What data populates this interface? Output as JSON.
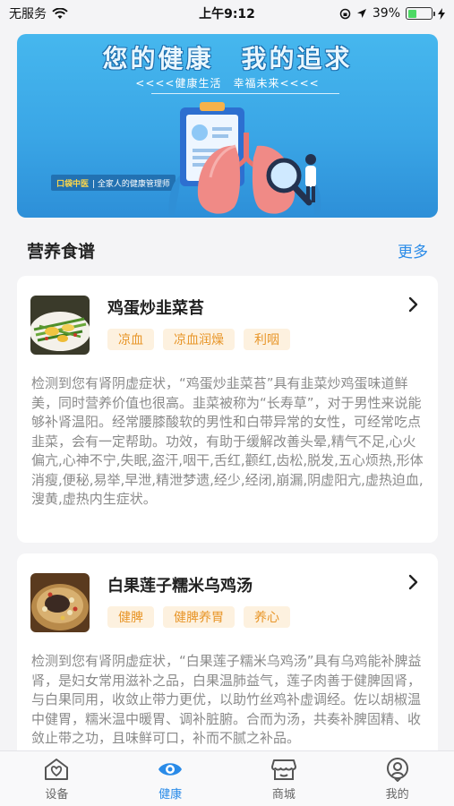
{
  "status_bar": {
    "carrier": "无服务",
    "time": "上午9:12",
    "battery_percent": "39%",
    "battery_level": 0.39
  },
  "banner": {
    "title": "您的健康　我的追求",
    "subtitle": "<<<<健康生活　幸福未来<<<<",
    "brand": "口袋中医",
    "brand_tagline": "| 全家人的健康管理师"
  },
  "section": {
    "title": "营养食谱",
    "more_label": "更多"
  },
  "recipes": [
    {
      "name": "鸡蛋炒韭菜苔",
      "tags": [
        "凉血",
        "凉血润燥",
        "利咽"
      ],
      "description": "检测到您有肾阴虚症状，“鸡蛋炒韭菜苔”具有韭菜炒鸡蛋味道鲜美，同时营养价值也很高。韭菜被称为“长寿草”，对于男性来说能够补肾温阳。经常腰膝酸软的男性和白带异常的女性，可经常吃点韭菜，会有一定帮助。功效，有助于缓解改善头晕,精气不足,心火偏亢,心神不宁,失眠,盗汗,咽干,舌红,颧红,齿松,脱发,五心烦热,形体消瘦,便秘,易举,早泄,精泄梦遗,经少,经闭,崩漏,阴虚阳亢,虚热迫血,溲黄,虚热内生症状。"
    },
    {
      "name": "白果莲子糯米乌鸡汤",
      "tags": [
        "健脾",
        "健脾养胃",
        "养心"
      ],
      "description": "检测到您有肾阴虚症状，“白果莲子糯米乌鸡汤”具有乌鸡能补脾益肾，是妇女常用滋补之品，白果温肺益气，莲子肉善于健脾固肾，与白果同用，收敛止带力更优，以助竹丝鸡补虚调经。佐以胡椒温中健胃，糯米温中暖胃、调补脏腑。合而为汤，共奏补脾固精、收敛止带之功，且味鲜可口，补而不腻之补品。"
    }
  ],
  "tabbar": {
    "items": [
      {
        "label": "设备",
        "icon": "device-icon",
        "active": false
      },
      {
        "label": "健康",
        "icon": "health-eye-icon",
        "active": true
      },
      {
        "label": "商城",
        "icon": "store-icon",
        "active": false
      },
      {
        "label": "我的",
        "icon": "profile-icon",
        "active": false
      }
    ]
  },
  "colors": {
    "accent": "#2a8be8",
    "tag_bg": "#fdf1df",
    "tag_text": "#e8962a",
    "banner_bg": "#3aa6e6"
  }
}
